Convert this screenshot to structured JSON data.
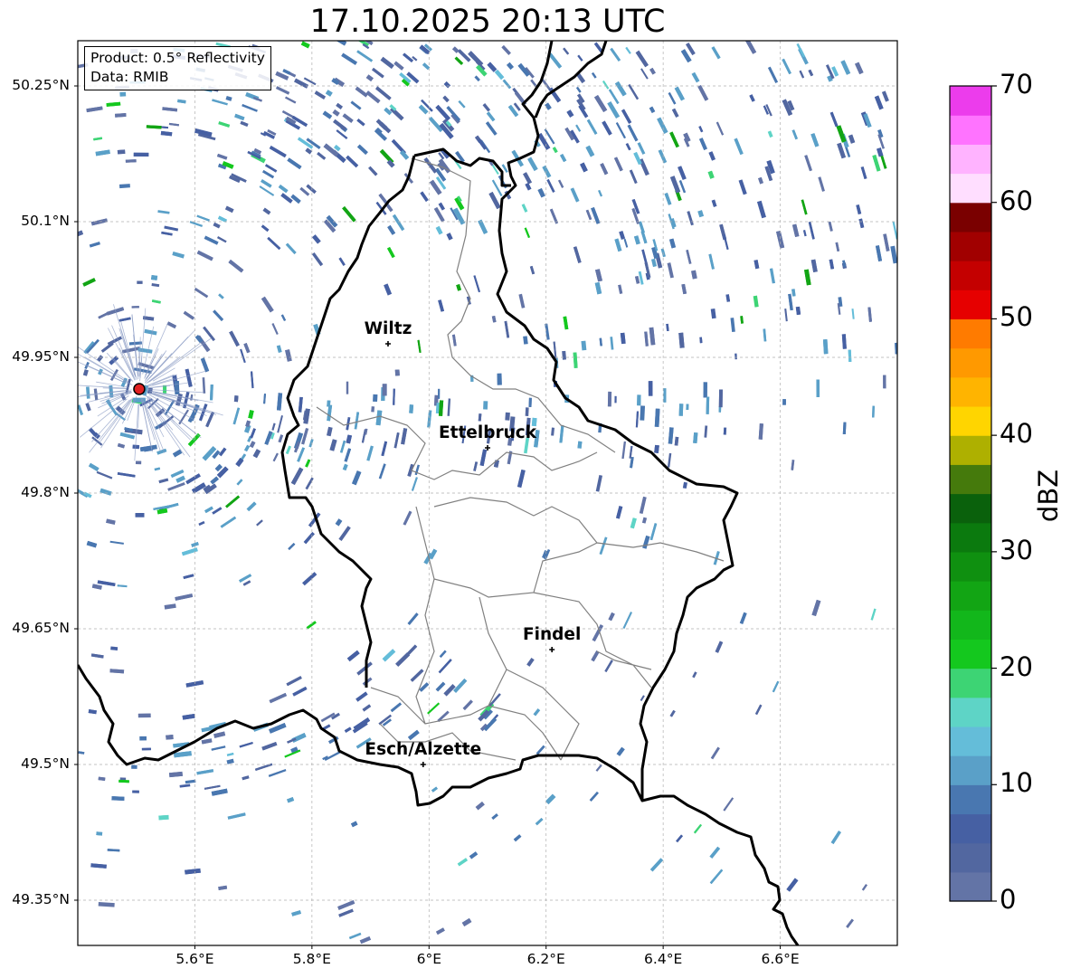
{
  "title": "17.10.2025 20:13 UTC",
  "info": {
    "product": "Product: 0.5° Reflectivity",
    "data": "Data: RMIB"
  },
  "map": {
    "lon_range": [
      5.4,
      6.8
    ],
    "lat_range": [
      49.3,
      50.3
    ],
    "lat_ticks": [
      "50.25°N",
      "50.1°N",
      "49.95°N",
      "49.8°N",
      "49.65°N",
      "49.5°N",
      "49.35°N"
    ],
    "lon_ticks": [
      "5.6°E",
      "5.8°E",
      "6°E",
      "6.2°E",
      "6.4°E",
      "6.6°E"
    ],
    "grid": true,
    "radar_site": {
      "lon": 5.505,
      "lat": 49.915
    },
    "cities": [
      {
        "name": "Wiltz",
        "lon": 5.93,
        "lat": 49.965
      },
      {
        "name": "Ettelbruck",
        "lon": 6.1,
        "lat": 49.85
      },
      {
        "name": "Findel",
        "lon": 6.21,
        "lat": 49.627
      },
      {
        "name": "Esch/Alzette",
        "lon": 5.99,
        "lat": 49.5
      }
    ]
  },
  "colorbar": {
    "label": "dBZ",
    "tick_labels": [
      "0",
      "10",
      "20",
      "30",
      "40",
      "50",
      "60",
      "70"
    ],
    "ticks": [
      0,
      10,
      20,
      30,
      40,
      50,
      60,
      70
    ],
    "colors": [
      "#6374a6",
      "#5267a0",
      "#4660a3",
      "#4977b0",
      "#5aa0c8",
      "#64bdd9",
      "#5ed4c6",
      "#3dd474",
      "#14c81e",
      "#12b71b",
      "#12a514",
      "#0f9010",
      "#0b7a0e",
      "#0a610c",
      "#457a0c",
      "#aeb000",
      "#ffd500",
      "#ffb400",
      "#ff9900",
      "#ff7b00",
      "#e60000",
      "#c40000",
      "#a10000",
      "#7a0000",
      "#ffdeff",
      "#ffb3ff",
      "#ff73ff",
      "#ec3cec"
    ]
  }
}
